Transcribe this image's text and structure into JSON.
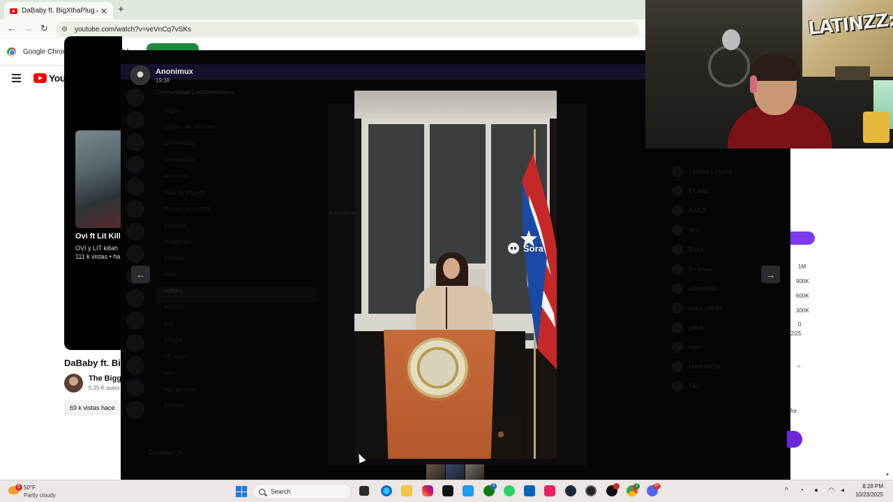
{
  "browser": {
    "tab_title": "DaBaby ft. BigXthaPlug & That",
    "tab_close": "✕",
    "new_tab": "+",
    "url": "youtube.com/watch?v=veVnCq7vSKs",
    "infobar_text": "Google Chrome isn't your default b"
  },
  "youtube": {
    "logo_text": "YouTube",
    "thumb_title": "Ovi ft Lit Killa",
    "thumb_line1": "OVI y LIT killah",
    "thumb_line2": "111 k vistas • ha",
    "video_title": "DaBaby ft. Big",
    "channel_name": "The Bigge",
    "channel_subs": "5.25 K suscr",
    "views": "69 k vistas  hace"
  },
  "discord": {
    "server_name": "Comunidad Latatxoriamos",
    "channels": [
      "reglas",
      "reglas del servidor",
      "bienvenida",
      "bienvenida",
      "anuncios",
      "sala de espera",
      "stream-anuncios",
      "general",
      "imágenes",
      "memes",
      "clips",
      "videos",
      "música",
      "bot",
      "juegos",
      "off-topic",
      "voz",
      "voz general",
      "Stream"
    ],
    "highlighted_channel": "videos",
    "user": "Canishair_X",
    "msg_author": "Anonimux",
    "members": [
      "Latatxo Legend",
      "5 Likes",
      "RATZI",
      "Bird",
      "Eusa",
      "En línea",
      "alRedonid",
      "lebra_dRdM",
      "yrAnt",
      "lopo",
      "Hard.WITH",
      "Tiki"
    ]
  },
  "viewer": {
    "author": "Anonimux",
    "time": "19:38",
    "prev_arrow": "←",
    "next_arrow": "→",
    "watermark": "Sora"
  },
  "right_panel": {
    "y_ticks": [
      "1M",
      "900K",
      "600K",
      "300K",
      "0"
    ],
    "date_fragment": "2/25",
    "for_text": "for",
    "chevron": "^",
    "scroll": "▾"
  },
  "webcam": {
    "graffiti_text": "LATINZZ:DA"
  },
  "taskbar": {
    "weather_badge": "5",
    "temperature": "50°F",
    "weather_desc": "Partly cloudy",
    "search_placeholder": "Search",
    "time": "8:28 PM",
    "date": "10/23/2025",
    "icons": [
      "file-explorer",
      "edge",
      "files",
      "instagram",
      "tiktok",
      "twitter",
      "xbox",
      "whatsapp",
      "store",
      "tiktok-studio",
      "steam",
      "obs",
      "obs-2",
      "chrome",
      "discord"
    ],
    "badges": [
      "3",
      "3",
      "9+"
    ],
    "tray_up": "^"
  },
  "colors": {
    "yt_red": "#ff0000",
    "discord_purple": "#7c3aed",
    "windows_blue": "#1e7be0"
  }
}
